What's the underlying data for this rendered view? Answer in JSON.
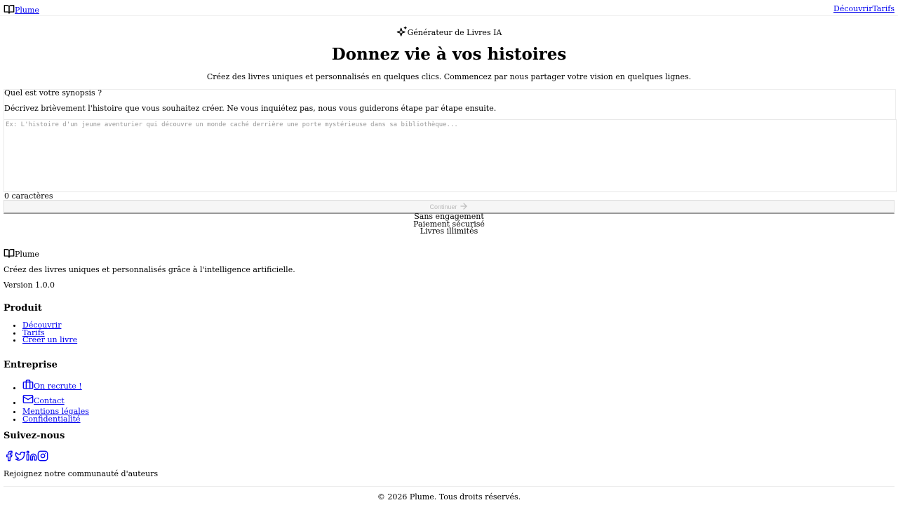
{
  "header": {
    "brand": "Plume",
    "nav": [
      "Découvrir",
      "Tarifs"
    ]
  },
  "hero": {
    "badge": "Générateur de Livres IA",
    "title": "Donnez vie à vos histoires",
    "subtitle": "Créez des livres uniques et personnalisés en quelques clics. Commencez par nous partager votre vision en quelques lignes."
  },
  "form": {
    "question": "Quel est votre synopsis ?",
    "description": "Décrivez brièvement l'histoire que vous souhaitez créer. Ne vous inquiétez pas, nous vous guiderons étape par étape ensuite.",
    "placeholder": "Ex: L'histoire d'un jeune aventurier qui découvre un monde caché derrière une porte mystérieuse dans sa bibliothèque...",
    "value": "",
    "char_count": "0 caractères",
    "continue_label": "Continuer"
  },
  "perks": [
    "Sans engagement",
    "Paiement sécurisé",
    "Livres illimités"
  ],
  "footer": {
    "brand": "Plume",
    "tagline": "Créez des livres uniques et personnalisés grâce à l'intelligence artificielle.",
    "version": "Version 1.0.0",
    "product": {
      "title": "Produit",
      "links": [
        "Découvrir",
        "Tarifs",
        "Créer un livre"
      ]
    },
    "company": {
      "title": "Entreprise",
      "links": [
        "On recrute !",
        "Contact",
        "Mentions légales",
        "Confidentialité"
      ]
    },
    "social": {
      "title": "Suivez-nous",
      "icons": [
        "facebook-icon",
        "twitter-icon",
        "linkedin-icon",
        "instagram-icon"
      ],
      "community": "Rejoignez notre communauté d'auteurs"
    },
    "copyright": "© 2026 Plume. Tous droits réservés."
  }
}
